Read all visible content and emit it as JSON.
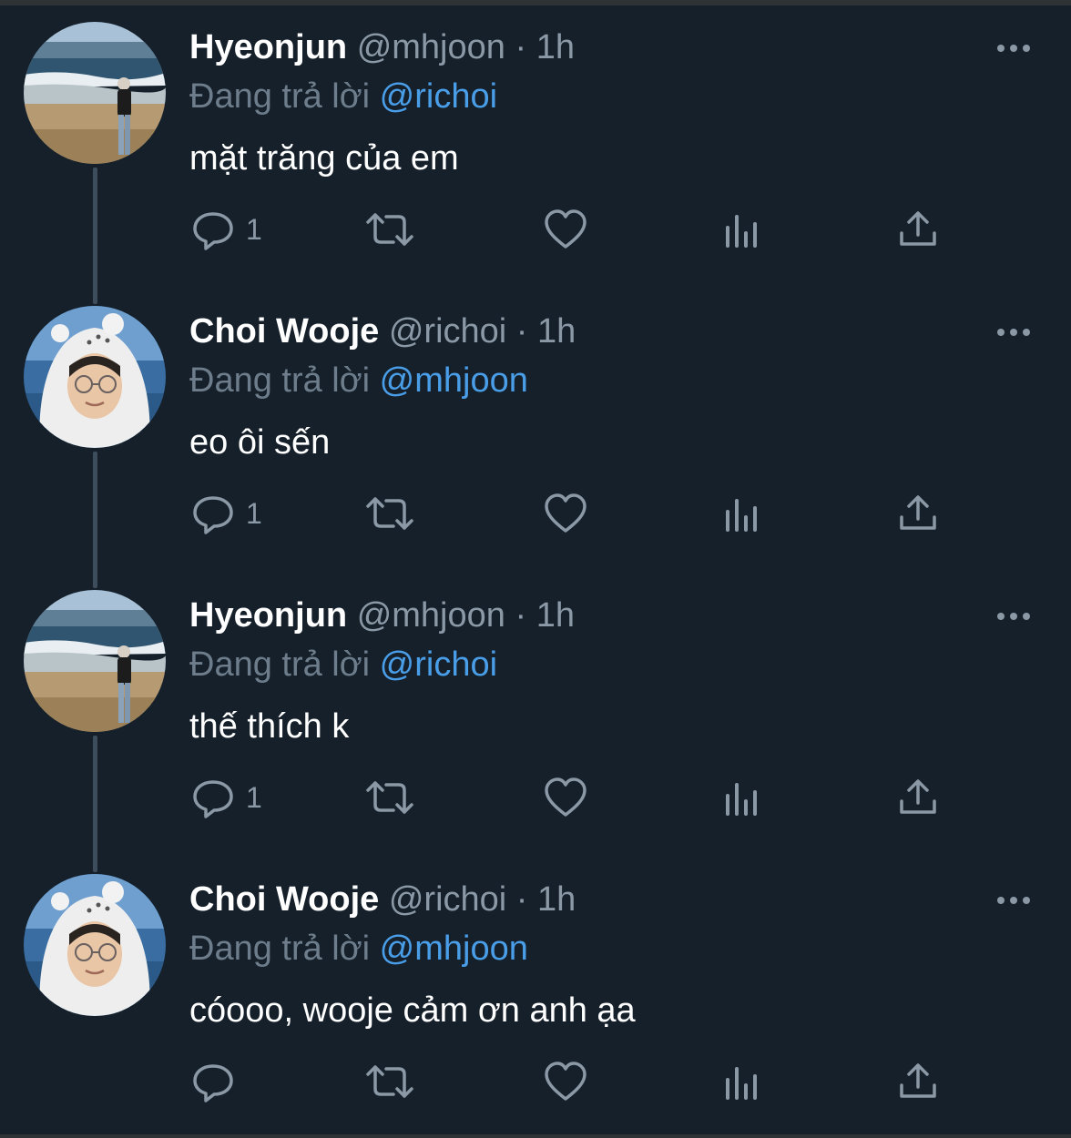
{
  "tweets": [
    {
      "name": "Hyeonjun",
      "handle": "@mhjoon",
      "sep": "·",
      "time": "1h",
      "reply_prefix": "Đang trả lời",
      "reply_to": "@richoi",
      "text": "mặt trăng của em",
      "reply_count": "1",
      "avatar": "beach-avatar"
    },
    {
      "name": "Choi Wooje",
      "handle": "@richoi",
      "sep": "·",
      "time": "1h",
      "reply_prefix": "Đang trả lời",
      "reply_to": "@mhjoon",
      "text": "eo ôi sến",
      "reply_count": "1",
      "avatar": "hood-avatar"
    },
    {
      "name": "Hyeonjun",
      "handle": "@mhjoon",
      "sep": "·",
      "time": "1h",
      "reply_prefix": "Đang trả lời",
      "reply_to": "@richoi",
      "text": "thế thích k",
      "reply_count": "1",
      "avatar": "beach-avatar"
    },
    {
      "name": "Choi Wooje",
      "handle": "@richoi",
      "sep": "·",
      "time": "1h",
      "reply_prefix": "Đang trả lời",
      "reply_to": "@mhjoon",
      "text": "cóooo, wooje cảm ơn anh ạa",
      "reply_count": "",
      "avatar": "hood-avatar"
    }
  ],
  "icons": {
    "reply": "speech-bubble-icon",
    "retweet": "retweet-icon",
    "like": "heart-icon",
    "analytics": "bar-chart-icon",
    "share": "share-upload-icon",
    "more": "more-dots-icon"
  },
  "colors": {
    "background": "#15202b",
    "name": "#ffffff",
    "secondary": "#8b98a5",
    "mention": "#4a9ee8",
    "thread_line": "#3d4d5c"
  }
}
